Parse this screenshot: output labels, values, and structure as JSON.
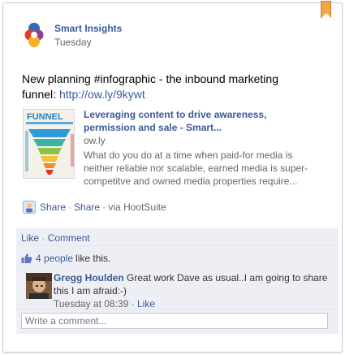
{
  "post": {
    "author": "Smart Insights",
    "time": "Tuesday",
    "text": "New planning #infographic - the inbound marketing funnel:",
    "link": "http://ow.ly/9kywt"
  },
  "attachment": {
    "title": "Leveraging content to drive awareness, permission and sale - Smart...",
    "domain": "ow.ly",
    "description": "What do you do at a time when paid-for media is neither reliable nor scalable, earned media is super-competitve and owned media properties require...",
    "thumbnail_heading": "FUNNEL"
  },
  "share_line": {
    "share_1": "Share",
    "separator": "·",
    "share_2": "Share",
    "via": "· via HootSuite"
  },
  "actions": {
    "like": "Like",
    "separator": "·",
    "comment": "Comment"
  },
  "likes": {
    "count_text": "4 people",
    "suffix": "like this."
  },
  "comment": {
    "author": "Gregg Houlden",
    "text": "Great work Dave as usual..I am going to share this I am afraid:-)",
    "time": "Tuesday at 08:39",
    "separator": "·",
    "like": "Like"
  },
  "composer": {
    "placeholder": "Write a comment..."
  },
  "colors": {
    "link": "#3b5998",
    "feedback_bg": "#edeff4",
    "bookmark": "#f1a54a"
  },
  "icons": {
    "bookmark": "bookmark-ribbon-icon",
    "logo": "smart-insights-logo",
    "share": "share-icon",
    "like": "thumbs-up-icon"
  }
}
